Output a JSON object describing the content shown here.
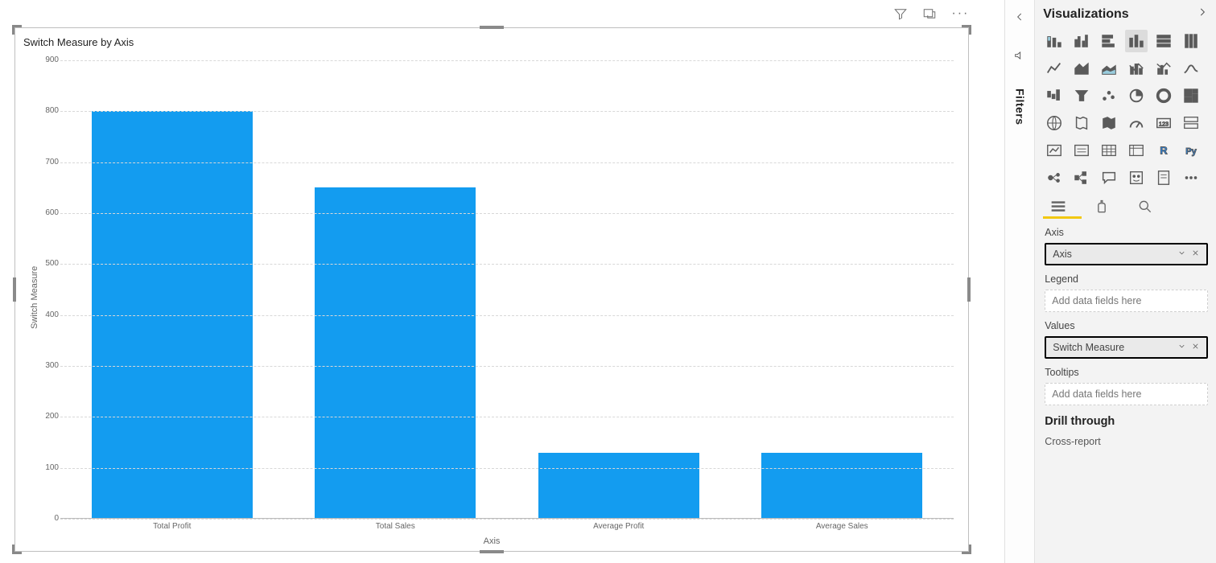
{
  "chart_data": {
    "type": "bar",
    "title": "Switch Measure by Axis",
    "xlabel": "Axis",
    "ylabel": "Switch Measure",
    "categories": [
      "Total Profit",
      "Total Sales",
      "Average Profit",
      "Average Sales"
    ],
    "values": [
      800,
      650,
      130,
      130
    ],
    "ylim": [
      0,
      900
    ],
    "y_ticks": [
      0,
      100,
      200,
      300,
      400,
      500,
      600,
      700,
      800,
      900
    ]
  },
  "filters_pane": {
    "title": "Filters"
  },
  "viz_pane": {
    "title": "Visualizations",
    "sections": {
      "axis": {
        "label": "Axis",
        "value": "Axis"
      },
      "legend": {
        "label": "Legend",
        "placeholder": "Add data fields here"
      },
      "values": {
        "label": "Values",
        "value": "Switch Measure"
      },
      "tooltips": {
        "label": "Tooltips",
        "placeholder": "Add data fields here"
      }
    },
    "drill_through_label": "Drill through",
    "cross_report_label": "Cross-report"
  }
}
